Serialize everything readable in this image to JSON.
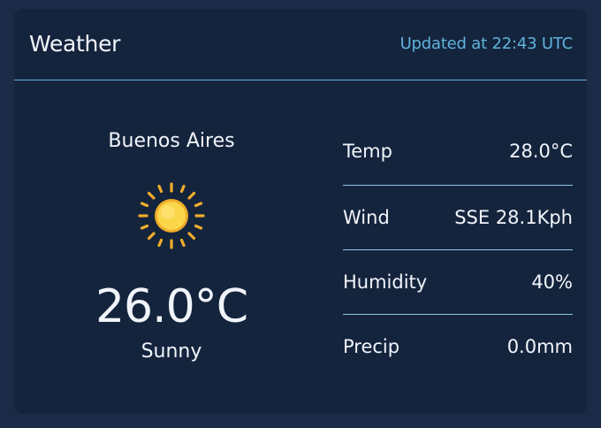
{
  "header": {
    "title": "Weather",
    "updated": "Updated at 22:43 UTC"
  },
  "current": {
    "city": "Buenos Aires",
    "icon": "sun-icon",
    "temperature": "26.0°C",
    "condition": "Sunny"
  },
  "details": [
    {
      "label": "Temp",
      "value": "28.0°C"
    },
    {
      "label": "Wind",
      "value": "SSE 28.1Kph"
    },
    {
      "label": "Humidity",
      "value": "40%"
    },
    {
      "label": "Precip",
      "value": "0.0mm"
    }
  ],
  "colors": {
    "background": "#1b2a47",
    "card": "#15243d",
    "accent": "#5fb4dc",
    "sun": "#f7c22e"
  }
}
